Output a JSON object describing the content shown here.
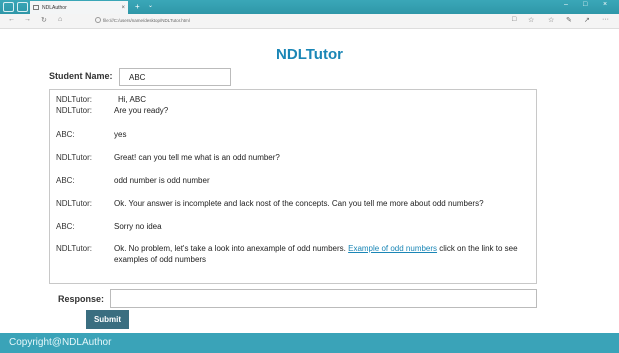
{
  "browser": {
    "tab_title": "NDLAuthor",
    "tab_close": "×",
    "new_tab": "+",
    "tab_dropdown": "⌄",
    "minimize": "–",
    "maximize": "□",
    "close": "×",
    "url": "file:///C:/users/name/desktop/NDLTutor.html",
    "back": "←",
    "forward": "→",
    "refresh": "↻",
    "home": "⌂",
    "reading_view": "□",
    "favorite": "☆",
    "favorites_hub": "☆",
    "pen": "✎",
    "share": "↗",
    "more": "···"
  },
  "page": {
    "title": "NDLTutor",
    "student_label": "Student Name:",
    "student_value": "ABC",
    "response_label": "Response:",
    "response_value": "",
    "submit_label": "Submit",
    "footer": "Copyright@NDLAuthor"
  },
  "chat": [
    {
      "speaker": "NDLTutor:",
      "text": "Hi, ABC"
    },
    {
      "speaker": "NDLTutor:",
      "text": "Are you ready?"
    },
    {
      "speaker": "ABC:",
      "text": "yes"
    },
    {
      "speaker": "NDLTutor:",
      "text": "Great! can you tell me what is an odd number?"
    },
    {
      "speaker": "ABC:",
      "text": "odd number is odd number"
    },
    {
      "speaker": "NDLTutor:",
      "text": "Ok. Your answer is incomplete and lack nost of the concepts. Can you tell me more about odd numbers?"
    },
    {
      "speaker": "ABC:",
      "text": "Sorry no idea"
    },
    {
      "speaker": "NDLTutor:",
      "text_before": "Ok. No problem, let's take a look into anexample of odd numbers.",
      "link": "Example of odd numbers",
      "text_after": "click on the link to see examples of odd numbers"
    }
  ]
}
